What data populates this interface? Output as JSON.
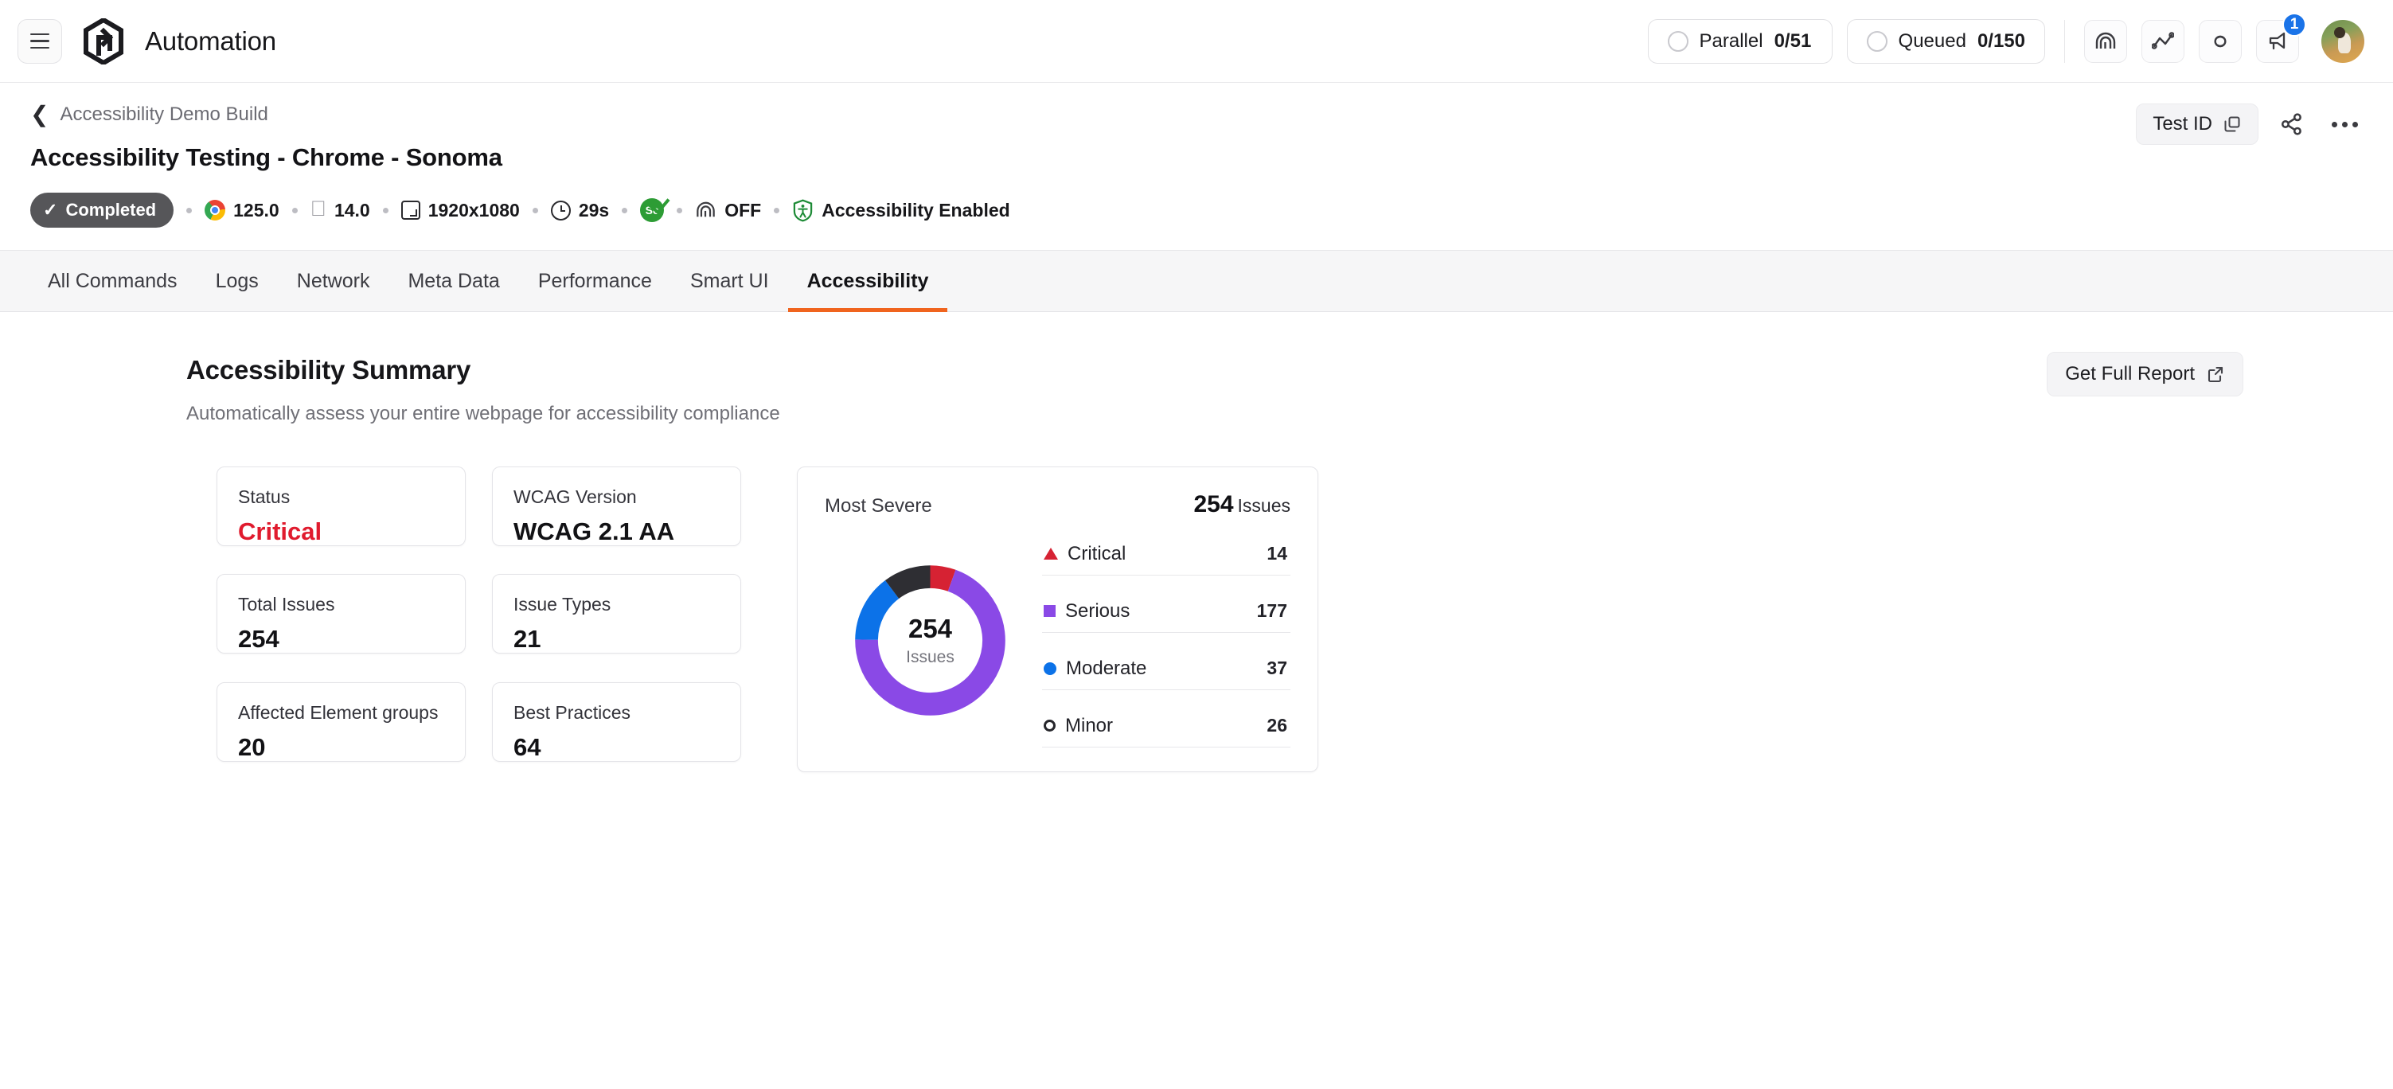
{
  "topbar": {
    "menu_icon": "hamburger-icon",
    "logo_icon": "lambdatest-logo-icon",
    "title": "Automation",
    "parallel": {
      "label": "Parallel",
      "count": "0/51"
    },
    "queued": {
      "label": "Queued",
      "count": "0/150"
    },
    "icons": [
      "fingerprint-icon",
      "analytics-icon",
      "integrations-icon",
      "announcements-icon"
    ],
    "notification_badge": "1",
    "avatar": "user-avatar"
  },
  "subheader": {
    "breadcrumb_back_icon": "chevron-left-icon",
    "breadcrumb": "Accessibility Demo Build",
    "title": "Accessibility Testing - Chrome - Sonoma",
    "status": "Completed",
    "meta": [
      {
        "icon": "chrome-icon",
        "text": "125.0"
      },
      {
        "icon": "apple-icon",
        "text": "14.0"
      },
      {
        "icon": "resolution-icon",
        "text": "1920x1080"
      },
      {
        "icon": "clock-icon",
        "text": "29s"
      },
      {
        "icon": "selenium-icon",
        "text": ""
      },
      {
        "icon": "fingerprint-icon",
        "text": "OFF"
      },
      {
        "icon": "accessibility-shield-icon",
        "text": "Accessibility Enabled"
      }
    ],
    "test_id_label": "Test ID",
    "copy_icon": "copy-icon",
    "share_icon": "share-icon",
    "more_icon": "more-options-icon"
  },
  "tabs": [
    {
      "label": "All Commands",
      "active": false
    },
    {
      "label": "Logs",
      "active": false
    },
    {
      "label": "Network",
      "active": false
    },
    {
      "label": "Meta Data",
      "active": false
    },
    {
      "label": "Performance",
      "active": false
    },
    {
      "label": "Smart UI",
      "active": false
    },
    {
      "label": "Accessibility",
      "active": true
    }
  ],
  "main": {
    "section_title": "Accessibility Summary",
    "section_subtitle": "Automatically assess your entire webpage for accessibility compliance",
    "report_button": "Get Full Report",
    "report_button_icon": "external-link-icon",
    "cards": [
      {
        "label": "Status",
        "value": "Critical",
        "critical": true
      },
      {
        "label": "WCAG Version",
        "value": "WCAG 2.1 AA",
        "critical": false
      },
      {
        "label": "Total Issues",
        "value": "254",
        "critical": false
      },
      {
        "label": "Issue Types",
        "value": "21",
        "critical": false
      },
      {
        "label": "Affected Element groups",
        "value": "20",
        "critical": false
      },
      {
        "label": "Best Practices",
        "value": "64",
        "critical": false
      }
    ]
  },
  "chart_data": {
    "type": "pie",
    "title": "Most Severe",
    "subtitle": "",
    "total_value": "254",
    "total_label": "Issues",
    "center_value": "254",
    "center_label": "Issues",
    "categories": [
      "Critical",
      "Serious",
      "Moderate",
      "Minor"
    ],
    "values": [
      14,
      177,
      37,
      26
    ],
    "colors": [
      "#d62233",
      "#8a49e6",
      "#0c72e8",
      "#2e2e33"
    ],
    "markers": [
      "triangle",
      "square",
      "circle",
      "ring"
    ],
    "legend_position": "right",
    "donut": true,
    "start_angle_deg": 0,
    "xlabel": "",
    "ylabel": ""
  },
  "accent_colors": {
    "tab_underline": "#f0641e",
    "critical_text": "#e01b2e",
    "badge_blue": "#1a73e8"
  }
}
